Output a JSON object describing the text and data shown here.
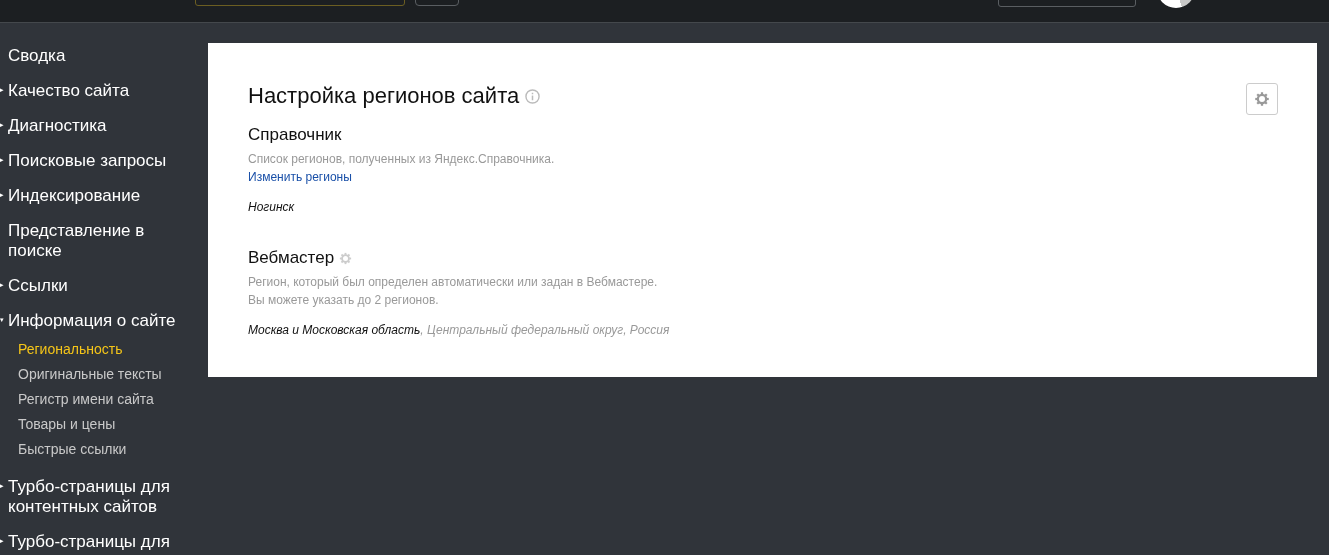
{
  "sidebar": {
    "items": [
      {
        "label": "Сводка"
      },
      {
        "arrow": "▸",
        "label": "Качество сайта"
      },
      {
        "arrow": "▸",
        "label": "Диагностика"
      },
      {
        "arrow": "▸",
        "label": "Поисковые запросы"
      },
      {
        "arrow": "▸",
        "label": "Индексирование"
      },
      {
        "label": "Представление в поиске"
      },
      {
        "arrow": "▸",
        "label": "Ссылки"
      },
      {
        "arrow": "▾",
        "label": "Информация о сайте",
        "children": [
          {
            "label": "Региональность",
            "selected": true
          },
          {
            "label": "Оригинальные тексты",
            "selected": false
          },
          {
            "label": "Регистр имени сайта",
            "selected": false
          },
          {
            "label": "Товары и цены",
            "selected": false
          },
          {
            "label": "Быстрые ссылки",
            "selected": false
          }
        ]
      },
      {
        "arrow": "▸",
        "label": "Турбо-страницы для контентных сайтов"
      },
      {
        "arrow": "▸",
        "label": "Турбо-страницы для"
      }
    ]
  },
  "card": {
    "title": "Настройка регионов сайта",
    "sections": [
      {
        "kind": "directory",
        "heading": "Справочник",
        "description": [
          "Список регионов, полученных из Яндекс.Справочника."
        ],
        "link": "Изменить регионы",
        "region": {
          "name": "Ногинск"
        }
      },
      {
        "kind": "webmaster",
        "heading": "Вебмастер",
        "description": [
          "Регион, который был определен автоматически или задан в Вебмастере.",
          "Вы можете указать до 2 регионов."
        ],
        "region": {
          "name": "Москва и Московская область",
          "rest": ", Центральный федеральный округ, Россия"
        }
      }
    ]
  }
}
